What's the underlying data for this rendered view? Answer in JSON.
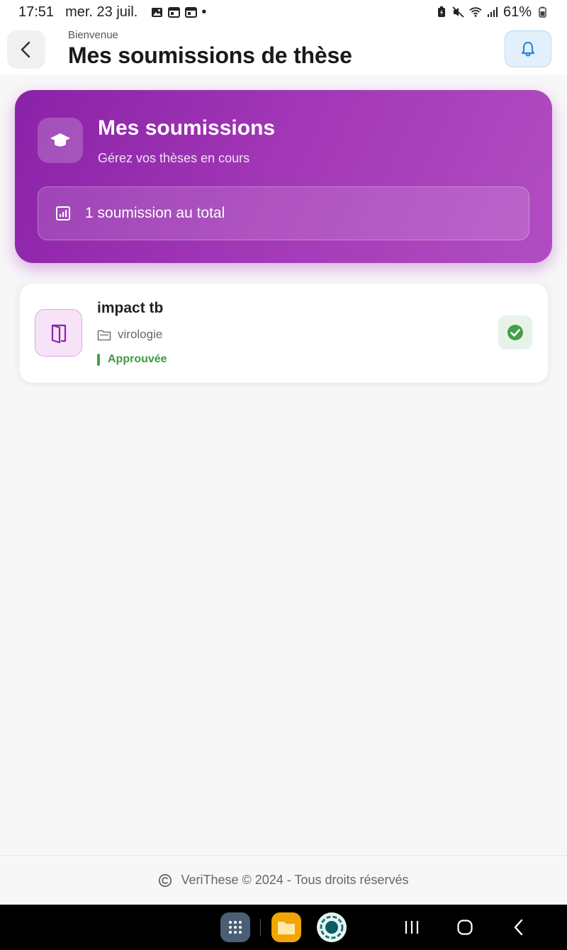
{
  "status_bar": {
    "time": "17:51",
    "date": "mer. 23 juil.",
    "dot": "•",
    "battery": "61%"
  },
  "header": {
    "subtitle": "Bienvenue",
    "title": "Mes soumissions de thèse"
  },
  "hero": {
    "title": "Mes soumissions",
    "subtitle": "Gérez vos thèses en cours",
    "stat": "1 soumission au total"
  },
  "submissions": [
    {
      "title": "impact tb",
      "category": "virologie",
      "status": "Approuvée"
    }
  ],
  "footer": {
    "text": "VeriThese © 2024 - Tous droits réservés"
  },
  "colors": {
    "accent": "#9c27b0",
    "approved": "#43a047",
    "bell": "#1e88e5"
  }
}
